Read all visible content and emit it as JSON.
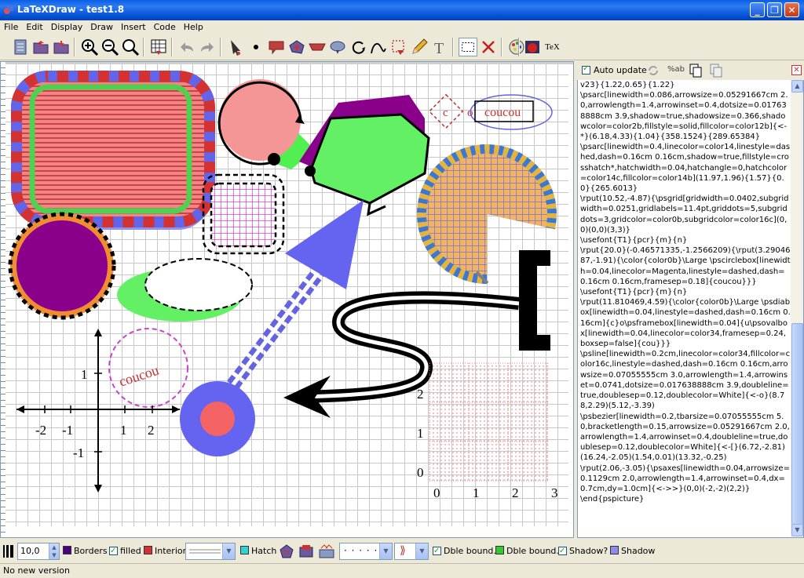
{
  "window": {
    "title": "LaTeXDraw - test1.8"
  },
  "menu": [
    "File",
    "Edit",
    "Display",
    "Draw",
    "Insert",
    "Code",
    "Help"
  ],
  "toolbar": {
    "tex_label": "TeX"
  },
  "canvas": {
    "texts": {
      "coucou_box": "coucou",
      "coucou_diamond": "c",
      "coucou_o": "o",
      "coucou_circle": "coucou"
    },
    "axes": {
      "x_ticks": [
        "-2",
        "-1",
        "1",
        "2"
      ],
      "y_ticks": [
        "1",
        "-1"
      ]
    },
    "grid": {
      "x_labels": [
        "0",
        "1",
        "2",
        "3"
      ],
      "y_labels": [
        "0",
        "1",
        "2"
      ]
    }
  },
  "code_panel": {
    "auto_update_label": "Auto update",
    "auto_update_checked": true,
    "format_label": "%ab",
    "code": "v23}{1.22,0.65}{1.22}\n\\psarc[linewidth=0.086,arrowsize=0.05291667cm 2.0,arrowlength=1.4,arrowinset=0.4,dotsize=0.017638888cm 3.9,shadow=true,shadowsize=0.366,shadowcolor=color2b,fillstyle=solid,fillcolor=color12b]{<-*}(6.18,4.33){1.04}{358.1524}{289.65384}\n\\psarc[linewidth=0.4,linecolor=color14,linestyle=dashed,dash=0.16cm 0.16cm,shadow=true,fillstyle=crosshatch*,hatchwidth=0.04,hatchangle=0,hatchcolor=color14c,fillcolor=color14b](11.97,1.96){1.57}{0.0}{265.6013}\n\\rput(10.52,-4.87){\\psgrid[gridwidth=0.0402,subgridwidth=0.0251,gridlabels=11.4pt,griddots=5,subgriddots=3,gridcolor=color0b,subgridcolor=color16c](0,0)(0,0)(3,3)}\n\\usefont{T1}{pcr}{m}{n}\n\\rput{20.0}(-0.46571335,-1.2566209){\\rput(3.2904687,-1.91){\\color{color0b}\\Large \\pscirclebox[linewidth=0.04,linecolor=Magenta,linestyle=dashed,dash=0.16cm 0.16cm,framesep=0.18]{coucou}}}\n\\usefont{T1}{pcr}{m}{n}\n\\rput(11.810469,4.59){\\color{color0b}\\Large \\psdiabox[linewidth=0.04,linestyle=dashed,dash=0.16cm 0.16cm]{c}o\\psframebox[linewidth=0.04]{u\\psovalbox[linewidth=0.04,linecolor=color34,framesep=0.24,boxsep=false]{cou}}}\n\\psline[linewidth=0.2cm,linecolor=color34,fillcolor=color16c,linestyle=dashed,dash=0.16cm 0.16cm,arrowsize=0.07055555cm 3.0,arrowlength=1.4,arrowinset=0.0741,dotsize=0.017638888cm 3.9,doubleline=true,doublesep=0.12,doublecolor=White]{<-o}(8.78,2.29)(5.12,-3.39)\n\\psbezier[linewidth=0.2,tbarsize=0.07055555cm 5.0,bracketlength=0.15,arrowsize=0.05291667cm 2.0,arrowlength=1.4,arrowinset=0.4,doubleline=true,doublesep=0.12,doublecolor=White]{<-[}(6.72,-2.81)(16.24,-2.05)(1.54,0.01)(13.32,-0.25)\n\\rput(2.06,-3.05){\\psaxes[linewidth=0.04,arrowsize=0.1129cm 2.0,arrowlength=1.4,arrowinset=0.4,dx=0.7cm,dy=1.0cm]{<->>}(0,0)(-2,-2)(2,2)}\n\\end{pspicture}"
  },
  "bottom": {
    "thickness_value": "10,0",
    "borders_label": "Borders",
    "filled_label": "filled",
    "filled_checked": true,
    "interior_label": "Interior",
    "hatch_label": "Hatch",
    "dble_bound_check_label": "Dble bound.",
    "dble_bound_check_checked": true,
    "dble_bound_color_label": "Dble bound.",
    "shadow_check_label": "Shadow?",
    "shadow_check_checked": true,
    "shadow_color_label": "Shadow",
    "colors": {
      "borders": "#4B0082",
      "interior": "#D23232",
      "hatch": "#32D2D2",
      "dble_bound": "#32C832",
      "shadow": "#8C8CF0"
    }
  },
  "status": {
    "text": "No new version"
  }
}
